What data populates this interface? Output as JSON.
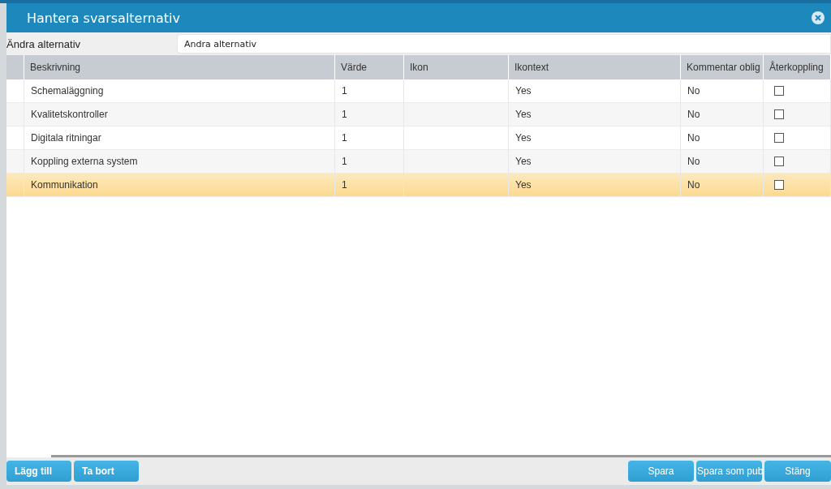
{
  "dialog": {
    "title": "Hantera svarsalternativ"
  },
  "field": {
    "label": "Ändra alternativ",
    "value": "Andra alternativ"
  },
  "table": {
    "columns": [
      "Beskrivning",
      "Värde",
      "Ikon",
      "Ikontext",
      "Kommentar oblig",
      "Återkoppling"
    ],
    "rows": [
      {
        "description": "Schemaläggning",
        "value": "1",
        "icon_text": "Yes",
        "comment_required": "No",
        "feedback": false,
        "selected": false
      },
      {
        "description": "Kvalitetskontroller",
        "value": "1",
        "icon_text": "Yes",
        "comment_required": "No",
        "feedback": false,
        "selected": false
      },
      {
        "description": "Digitala ritningar",
        "value": "1",
        "icon_text": "Yes",
        "comment_required": "No",
        "feedback": false,
        "selected": false
      },
      {
        "description": "Koppling externa system",
        "value": "1",
        "icon_text": "Yes",
        "comment_required": "No",
        "feedback": false,
        "selected": false
      },
      {
        "description": "Kommunikation",
        "value": "1",
        "icon_text": "Yes",
        "comment_required": "No",
        "feedback": false,
        "selected": true
      }
    ]
  },
  "buttons_left": [
    "Lägg till",
    "Ta bort"
  ],
  "buttons_right": [
    "Spara",
    "Spara som pub",
    "Stäng"
  ]
}
